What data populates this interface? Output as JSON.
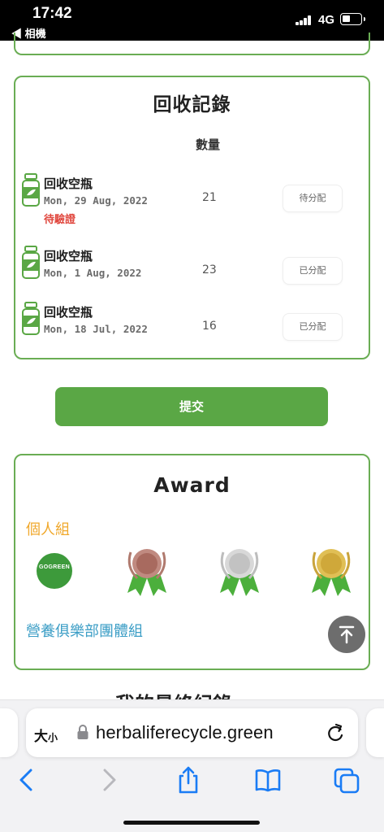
{
  "status_bar": {
    "time": "17:42",
    "back_label": "◀ 相機",
    "network": "4G"
  },
  "records": {
    "title": "回收記錄",
    "quantity_header": "數量",
    "items": [
      {
        "name": "回收空瓶",
        "date": "Mon, 29 Aug, 2022",
        "note": "待驗證",
        "quantity": "21",
        "status": "待分配"
      },
      {
        "name": "回收空瓶",
        "date": "Mon, 1 Aug, 2022",
        "note": "",
        "quantity": "23",
        "status": "已分配"
      },
      {
        "name": "回收空瓶",
        "date": "Mon, 18 Jul, 2022",
        "note": "",
        "quantity": "16",
        "status": "已分配"
      }
    ]
  },
  "submit_label": "提交",
  "award": {
    "title": "Award",
    "personal_group": "個人組",
    "team_group": "營養俱樂部團體組",
    "badge_text": "GOGREEN",
    "medals": [
      "bronze",
      "silver",
      "gold"
    ]
  },
  "next_section_partial": "我的最終紀錄",
  "browser": {
    "text_size_big": "大",
    "text_size_small": "小",
    "url": "herbaliferecycle.green"
  },
  "colors": {
    "accent_green": "#5aa745",
    "card_border": "#6aad54",
    "pending_red": "#e0463d",
    "personal_orange": "#f0a82b",
    "team_blue": "#3c9ec6",
    "ios_blue": "#1a7cf5"
  }
}
